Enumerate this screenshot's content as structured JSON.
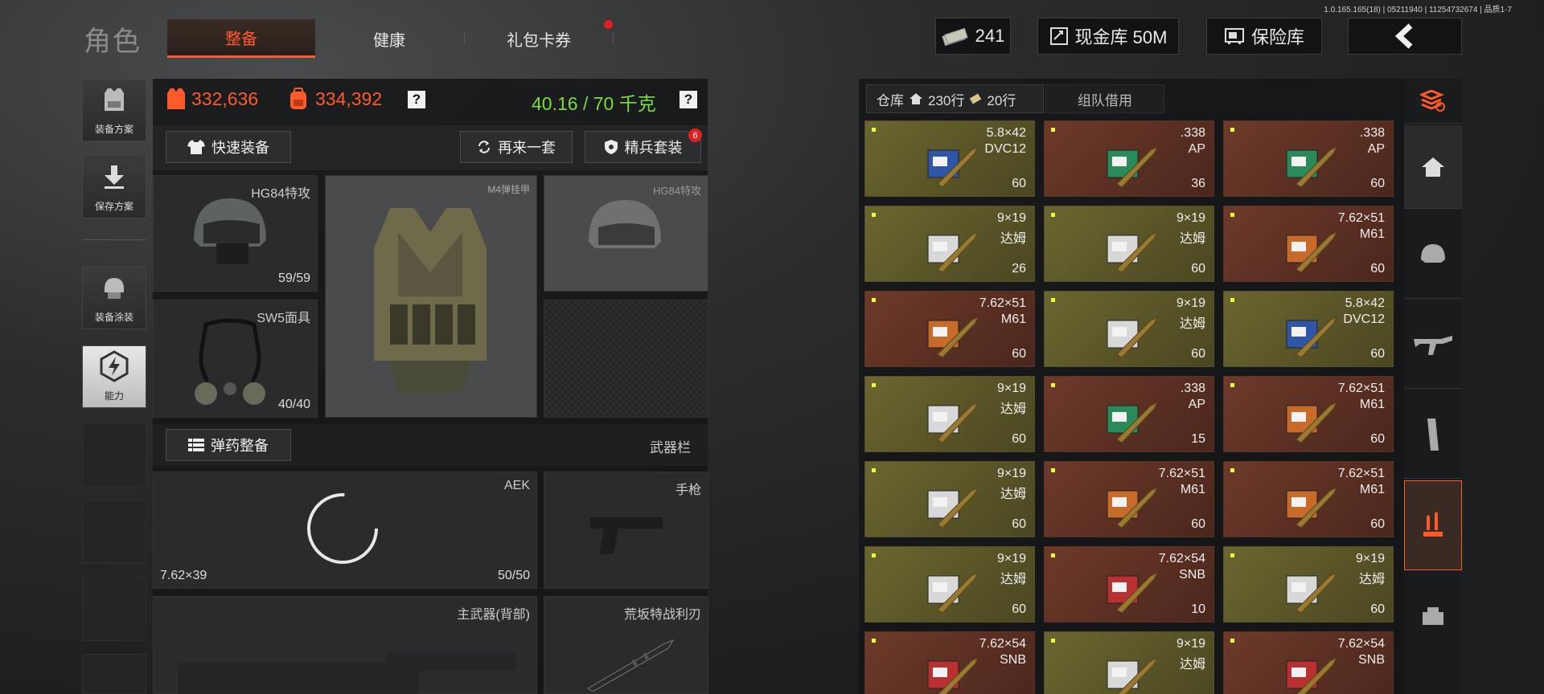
{
  "version": "1.0.165.165(18) | 05211940 | 11254732674 | 品质1-7",
  "header": {
    "title": "角色",
    "tabs": [
      {
        "label": "整备",
        "active": true
      },
      {
        "label": "健康",
        "active": false
      },
      {
        "label": "礼包卡券",
        "active": false
      }
    ],
    "currency_count": "241",
    "cash_vault": "现金库 50M",
    "safe_label": "保险库"
  },
  "sidebar": [
    {
      "label": "装备方案"
    },
    {
      "label": "保存方案"
    },
    {
      "label": "装备涂装"
    },
    {
      "label": "能力"
    }
  ],
  "stats": {
    "armor_value": "332,636",
    "bag_value": "334,392",
    "weight": "40.16 / 70 千克",
    "help": "?"
  },
  "buttons": {
    "quick_equip": "快速装备",
    "again": "再来一套",
    "elite": "精兵套装",
    "elite_badge": "6",
    "ammo": "弹药整备",
    "weapon_bar": "武器栏"
  },
  "slots": {
    "helmet": {
      "label": "HG84特攻",
      "count": "59/59"
    },
    "armor": {
      "label": "M4弹挂甲"
    },
    "helmet2": {
      "label": "HG84特攻"
    },
    "mask": {
      "label": "SW5面具",
      "count": "40/40"
    },
    "primary": {
      "label": "AEK",
      "caliber": "7.62×39",
      "count": "50/50"
    },
    "pistol": {
      "label": "手枪"
    },
    "back": {
      "label": "主武器(背部)"
    },
    "knife": {
      "label": "荒坂特战利刃"
    }
  },
  "storage": {
    "tab_label": "仓库",
    "rows_a": "230行",
    "rows_b": "20行",
    "team_label": "组队借用"
  },
  "items": [
    {
      "cal": "5.8×42",
      "name": "DVC12",
      "qty": "60",
      "tone": "y",
      "kind": "blue"
    },
    {
      "cal": ".338",
      "name": "AP",
      "qty": "36",
      "tone": "r",
      "kind": "green"
    },
    {
      "cal": ".338",
      "name": "AP",
      "qty": "60",
      "tone": "r",
      "kind": "green"
    },
    {
      "cal": "9×19",
      "name": "达姆",
      "qty": "26",
      "tone": "y",
      "kind": "white"
    },
    {
      "cal": "9×19",
      "name": "达姆",
      "qty": "60",
      "tone": "y",
      "kind": "white"
    },
    {
      "cal": "7.62×51",
      "name": "M61",
      "qty": "60",
      "tone": "r",
      "kind": "orange"
    },
    {
      "cal": "7.62×51",
      "name": "M61",
      "qty": "60",
      "tone": "r",
      "kind": "orange"
    },
    {
      "cal": "9×19",
      "name": "达姆",
      "qty": "60",
      "tone": "y",
      "kind": "white"
    },
    {
      "cal": "5.8×42",
      "name": "DVC12",
      "qty": "60",
      "tone": "y",
      "kind": "blue"
    },
    {
      "cal": "9×19",
      "name": "达姆",
      "qty": "60",
      "tone": "y",
      "kind": "white"
    },
    {
      "cal": ".338",
      "name": "AP",
      "qty": "15",
      "tone": "r",
      "kind": "green"
    },
    {
      "cal": "7.62×51",
      "name": "M61",
      "qty": "60",
      "tone": "r",
      "kind": "orange"
    },
    {
      "cal": "9×19",
      "name": "达姆",
      "qty": "60",
      "tone": "y",
      "kind": "white"
    },
    {
      "cal": "7.62×51",
      "name": "M61",
      "qty": "60",
      "tone": "r",
      "kind": "orange"
    },
    {
      "cal": "7.62×51",
      "name": "M61",
      "qty": "60",
      "tone": "r",
      "kind": "orange"
    },
    {
      "cal": "9×19",
      "name": "达姆",
      "qty": "60",
      "tone": "y",
      "kind": "white"
    },
    {
      "cal": "7.62×54",
      "name": "SNB",
      "qty": "10",
      "tone": "r",
      "kind": "red"
    },
    {
      "cal": "9×19",
      "name": "达姆",
      "qty": "60",
      "tone": "y",
      "kind": "white"
    },
    {
      "cal": "7.62×54",
      "name": "SNB",
      "qty": "",
      "tone": "r",
      "kind": "red"
    },
    {
      "cal": "9×19",
      "name": "达姆",
      "qty": "",
      "tone": "y",
      "kind": "white"
    },
    {
      "cal": "7.62×54",
      "name": "SNB",
      "qty": "",
      "tone": "r",
      "kind": "red"
    }
  ],
  "colors": {
    "accent": "#ff5a2a",
    "weight_ok": "#7cdc3c"
  }
}
